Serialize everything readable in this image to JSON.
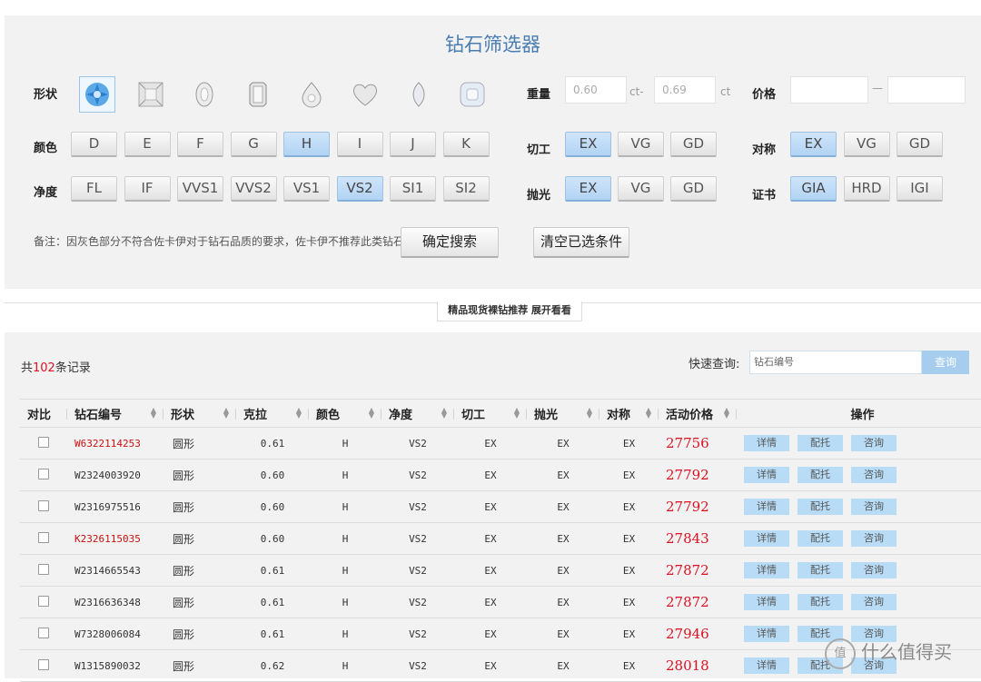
{
  "title": "钻石筛选器",
  "labels": {
    "shape": "形状",
    "color": "颜色",
    "clarity": "净度",
    "weight": "重量",
    "price": "价格",
    "cut": "切工",
    "polish": "抛光",
    "symmetry": "对称",
    "cert": "证书"
  },
  "shapes": [
    "round-icon",
    "princess-icon",
    "oval-icon",
    "emerald-icon",
    "pear-icon",
    "heart-icon",
    "marquise-icon",
    "cushion-icon"
  ],
  "colors": [
    {
      "label": "D",
      "selected": false
    },
    {
      "label": "E",
      "selected": false
    },
    {
      "label": "F",
      "selected": false
    },
    {
      "label": "G",
      "selected": false
    },
    {
      "label": "H",
      "selected": true
    },
    {
      "label": "I",
      "selected": false
    },
    {
      "label": "J",
      "selected": false
    },
    {
      "label": "K",
      "selected": false
    }
  ],
  "clarities": [
    {
      "label": "FL",
      "selected": false
    },
    {
      "label": "IF",
      "selected": false
    },
    {
      "label": "VVS1",
      "selected": false
    },
    {
      "label": "VVS2",
      "selected": false
    },
    {
      "label": "VS1",
      "selected": false
    },
    {
      "label": "VS2",
      "selected": true
    },
    {
      "label": "SI1",
      "selected": false
    },
    {
      "label": "SI2",
      "selected": false
    }
  ],
  "weight": {
    "min": "0.60",
    "min_unit": "ct-",
    "max": "0.69",
    "max_unit": "ct"
  },
  "price": {
    "min": "",
    "sep": "—",
    "max": ""
  },
  "cut": [
    {
      "label": "EX",
      "selected": true
    },
    {
      "label": "VG",
      "selected": false
    },
    {
      "label": "GD",
      "selected": false
    }
  ],
  "polish": [
    {
      "label": "EX",
      "selected": true
    },
    {
      "label": "VG",
      "selected": false
    },
    {
      "label": "GD",
      "selected": false
    }
  ],
  "symmetry": [
    {
      "label": "EX",
      "selected": true
    },
    {
      "label": "VG",
      "selected": false
    },
    {
      "label": "GD",
      "selected": false
    }
  ],
  "cert": [
    {
      "label": "GIA",
      "selected": true
    },
    {
      "label": "HRD",
      "selected": false
    },
    {
      "label": "IGI",
      "selected": false
    }
  ],
  "note": "备注：因灰色部分不符合佐卡伊对于钻石品质的要求，佐卡伊不推荐此类钻石",
  "confirm_label": "确定搜索",
  "clear_label": "清空已选条件",
  "recommend_tab": "精品现货裸钻推荐 展开看看",
  "count_prefix": "共",
  "count_num": "102",
  "count_suffix": "条记录",
  "quick_label": "快速查询:",
  "search_placeholder": "钻石编号",
  "search_btn": "查询",
  "columns": [
    "对比",
    "钻石编号",
    "形状",
    "克拉",
    "颜色",
    "净度",
    "切工",
    "抛光",
    "对称",
    "活动价格",
    "操作"
  ],
  "actions": [
    "详情",
    "配托",
    "咨询"
  ],
  "rows": [
    {
      "code": "W6322114253",
      "red": true,
      "shape": "圆形",
      "carat": "0.61",
      "color": "H",
      "clarity": "VS2",
      "cut": "EX",
      "polish": "EX",
      "sym": "EX",
      "price": "27756"
    },
    {
      "code": "W2324003920",
      "red": false,
      "shape": "圆形",
      "carat": "0.60",
      "color": "H",
      "clarity": "VS2",
      "cut": "EX",
      "polish": "EX",
      "sym": "EX",
      "price": "27792"
    },
    {
      "code": "W2316975516",
      "red": false,
      "shape": "圆形",
      "carat": "0.60",
      "color": "H",
      "clarity": "VS2",
      "cut": "EX",
      "polish": "EX",
      "sym": "EX",
      "price": "27792"
    },
    {
      "code": "K2326115035",
      "red": true,
      "shape": "圆形",
      "carat": "0.60",
      "color": "H",
      "clarity": "VS2",
      "cut": "EX",
      "polish": "EX",
      "sym": "EX",
      "price": "27843"
    },
    {
      "code": "W2314665543",
      "red": false,
      "shape": "圆形",
      "carat": "0.61",
      "color": "H",
      "clarity": "VS2",
      "cut": "EX",
      "polish": "EX",
      "sym": "EX",
      "price": "27872"
    },
    {
      "code": "W2316636348",
      "red": false,
      "shape": "圆形",
      "carat": "0.61",
      "color": "H",
      "clarity": "VS2",
      "cut": "EX",
      "polish": "EX",
      "sym": "EX",
      "price": "27872"
    },
    {
      "code": "W7328006084",
      "red": false,
      "shape": "圆形",
      "carat": "0.61",
      "color": "H",
      "clarity": "VS2",
      "cut": "EX",
      "polish": "EX",
      "sym": "EX",
      "price": "27946"
    },
    {
      "code": "W1315890032",
      "red": false,
      "shape": "圆形",
      "carat": "0.62",
      "color": "H",
      "clarity": "VS2",
      "cut": "EX",
      "polish": "EX",
      "sym": "EX",
      "price": "28018"
    }
  ],
  "watermark": "什么值得买",
  "watermark_logo": "值"
}
